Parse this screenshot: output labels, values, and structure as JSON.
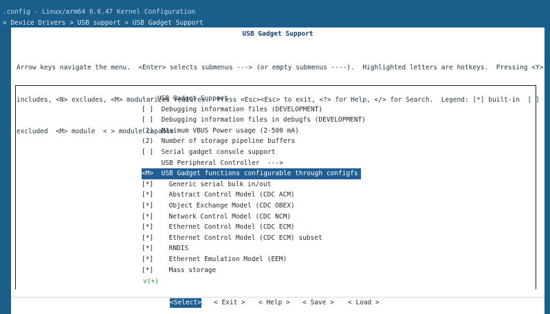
{
  "window": {
    "title": ".config - Linux/arm64 6.6.47 Kernel Configuration",
    "breadcrumb": "> Device Drivers > USB support > USB Gadget Support"
  },
  "dialog": {
    "title": "USB Gadget Support",
    "help_lines": [
      "Arrow keys navigate the menu.  <Enter> selects submenus ---> (or empty submenus ----).  Highlighted letters are hotkeys.  Pressing <Y>",
      "includes, <N> excludes, <M> modularizes features.  Press <Esc><Esc> to exit, <?> for Help, </> for Search.  Legend: [*] built-in  [ ]",
      "excluded  <M> module  < > module capable"
    ]
  },
  "menu": {
    "items": [
      {
        "prefix": "--- ",
        "label": "USB Gadget Support",
        "indent": 0
      },
      {
        "prefix": "[ ]  ",
        "label": "Debugging information files (DEVELOPMENT)",
        "indent": 0
      },
      {
        "prefix": "[ ]  ",
        "label": "Debugging information files in debugfs (DEVELOPMENT)",
        "indent": 0
      },
      {
        "prefix": "(2)  ",
        "label": "Maximum VBUS Power usage (2-500 mA)",
        "indent": 0
      },
      {
        "prefix": "(2)  ",
        "label": "Number of storage pipeline buffers",
        "indent": 0
      },
      {
        "prefix": "[ ]  ",
        "label": "Serial gadget console support",
        "indent": 0
      },
      {
        "prefix": "     ",
        "label": "USB Peripheral Controller  --->",
        "indent": 0
      },
      {
        "prefix": "<M>  ",
        "label": "USB Gadget functions configurable through configfs",
        "indent": 0,
        "selected": true
      },
      {
        "prefix": "[*]  ",
        "label": "Generic serial bulk in/out",
        "indent": 1
      },
      {
        "prefix": "[*]  ",
        "label": "Abstract Control Model (CDC ACM)",
        "indent": 1
      },
      {
        "prefix": "[*]  ",
        "label": "Object Exchange Model (CDC OBEX)",
        "indent": 1
      },
      {
        "prefix": "[*]  ",
        "label": "Network Control Model (CDC NCM)",
        "indent": 1
      },
      {
        "prefix": "[*]  ",
        "label": "Ethernet Control Model (CDC ECM)",
        "indent": 1
      },
      {
        "prefix": "[*]  ",
        "label": "Ethernet Control Model (CDC ECM) subset",
        "indent": 1
      },
      {
        "prefix": "[*]  ",
        "label": "RNDIS",
        "indent": 1
      },
      {
        "prefix": "[*]  ",
        "label": "Ethernet Emulation Model (EEM)",
        "indent": 1
      },
      {
        "prefix": "[*]  ",
        "label": "Mass storage",
        "indent": 1
      }
    ],
    "more_indicator": "v(+)"
  },
  "buttons": [
    {
      "label": "<Select>",
      "active": true
    },
    {
      "label": "< Exit >",
      "active": false
    },
    {
      "label": "< Help >",
      "active": false
    },
    {
      "label": "< Save >",
      "active": false
    },
    {
      "label": "< Load >",
      "active": false
    }
  ],
  "colors": {
    "background": "#1a5f8c",
    "dialog": "#ffffff",
    "selection": "#1f5f93",
    "hotkey": "#1d5fa8",
    "button_hotkey": "#b42222",
    "more_indicator": "#2c8c38"
  }
}
